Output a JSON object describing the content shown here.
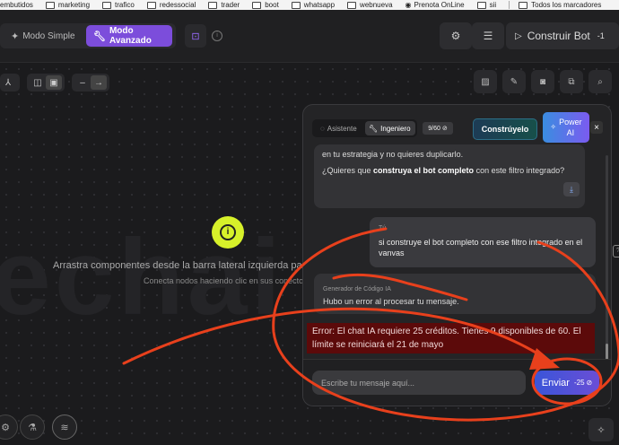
{
  "bookmarks": [
    "embutidos",
    "marketing",
    "trafico",
    "redessocial",
    "trader",
    "boot",
    "whatsapp",
    "webnueva",
    "Prenota OnLine",
    "sii",
    "Todos los marcadores"
  ],
  "toolbar": {
    "mode_simple": "Modo Simple",
    "mode_advanced": "Modo Avanzado",
    "build_label": "Construir Bot",
    "build_count": "-1"
  },
  "canvas": {
    "watermark": "echai",
    "empty_title": "Arrastra componentes desde la barra lateral izquierda para co",
    "empty_subtitle": "Conecta nodos haciendo clic en sus conecto"
  },
  "chat": {
    "tab_assistant": "Asistente",
    "tab_engineer": "Ingeniero",
    "credits": "9/60",
    "construir_label": "Constrúyelo",
    "power_label_1": "Power",
    "power_label_2": "AI",
    "close": "×",
    "ai_msg_1_line1": "en tu estrategia y no quieres duplicarlo.",
    "ai_msg_1_pre": "¿Quieres que ",
    "ai_msg_1_bold": "construya el bot completo",
    "ai_msg_1_post": " con este filtro integrado?",
    "user_label": "Tú",
    "user_msg": "si construye el bot completo con ese filtro integrado en el vanvas",
    "ai2_label": "Generador de Código IA",
    "ai2_msg": "Hubo un error al procesar tu mensaje.",
    "error_text": "Error: El chat IA requiere 25 créditos. Tienes 9 disponibles de 60. El límite se reiniciará el 21 de mayo",
    "input_placeholder": "Escribe tu mensaje aquí...",
    "send_label": "Enviar",
    "send_cost": "-25"
  },
  "colors": {
    "accent_purple": "#7c4ddb",
    "highlight_yellow": "#d7f12a",
    "error_bg": "#5c0a0a",
    "annotation_red": "#e8401c"
  }
}
